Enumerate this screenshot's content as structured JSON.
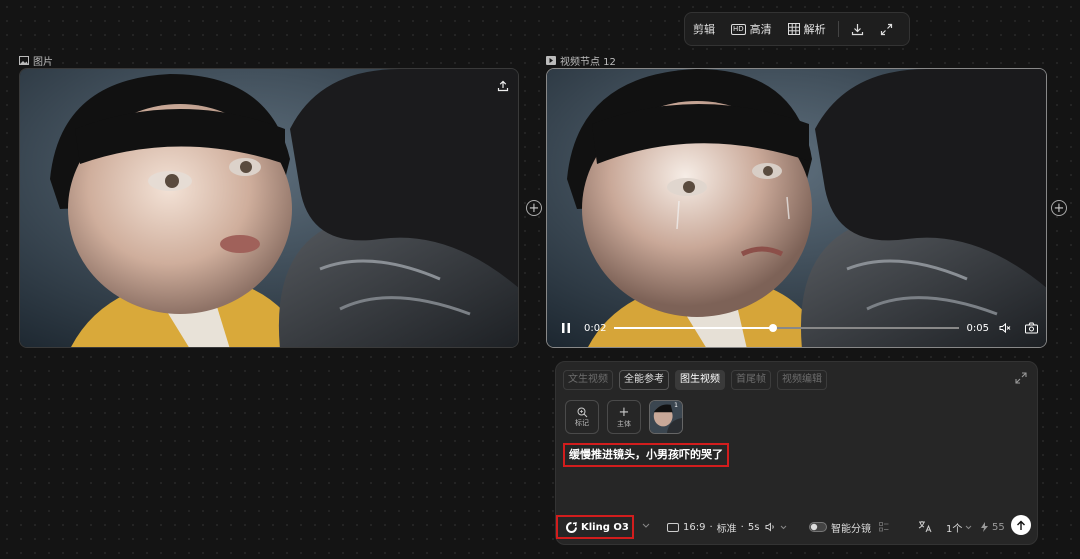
{
  "toolbar": {
    "edit_label": "剪辑",
    "hd_badge": "HD",
    "hd_label": "高清",
    "analyze_label": "解析"
  },
  "image_node": {
    "label": "图片"
  },
  "video_node": {
    "label": "视频节点 12",
    "current_time": "0:02",
    "duration": "0:05",
    "progress": 0.46
  },
  "panel": {
    "modes": [
      "文生视频",
      "全能参考",
      "图生视频",
      "首尾帧",
      "视频编辑"
    ],
    "selected_mode": "图生视频",
    "tiles": {
      "mark_label": "标记",
      "subject_label": "主体",
      "thumb_count": "1"
    },
    "prompt_text": "缓慢推进镜头，小男孩吓的哭了",
    "model_name": "Kling O3",
    "aspect": "16:9",
    "quality": "标准",
    "separator": "·",
    "duration": "5s",
    "smart_shot_label": "智能分镜",
    "count_label": "1个",
    "credits": "55"
  },
  "colors": {
    "background": "#141414",
    "highlight_box": "#d21d1d",
    "panel": "#262626"
  }
}
